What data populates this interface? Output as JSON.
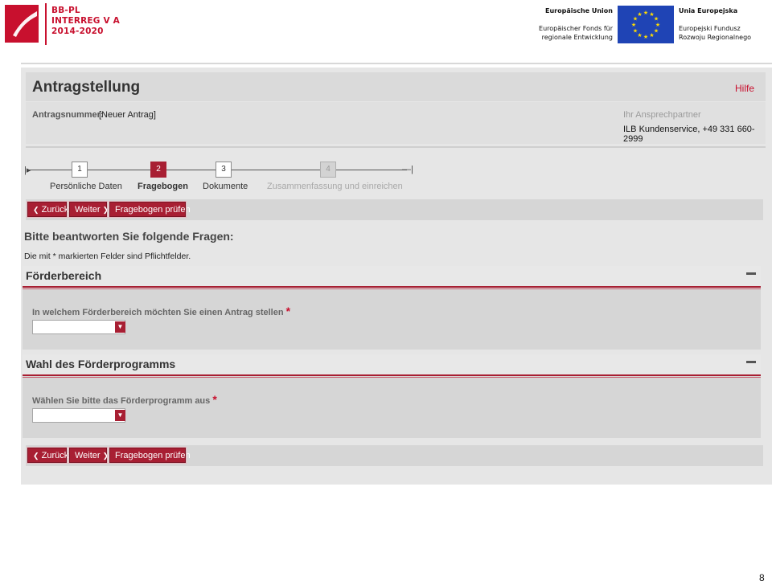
{
  "header": {
    "logo_lines": [
      "BB-PL",
      "INTERREG V A",
      "2014-2020"
    ],
    "eu_left_title": "Europäische Union",
    "eu_left_sub": [
      "Europäischer Fonds für",
      "regionale Entwicklung"
    ],
    "eu_right_title": "Unia Europejska",
    "eu_right_sub": [
      "Europejski Fundusz",
      "Rozwoju Regionalnego"
    ]
  },
  "page": {
    "title": "Antragstellung",
    "help": "Hilfe",
    "application_label": "Antragsnummer:",
    "application_value": "[Neuer Antrag]",
    "contact_label": "Ihr Ansprechpartner",
    "contact_value": "ILB Kundenservice, +49 331 660-2999"
  },
  "steps": [
    {
      "num": "1",
      "label": "Persönliche Daten"
    },
    {
      "num": "2",
      "label": "Fragebogen"
    },
    {
      "num": "3",
      "label": "Dokumente"
    },
    {
      "num": "4",
      "label": "Zusammenfassung und einreichen"
    }
  ],
  "buttons": {
    "back": "Zurück",
    "next": "Weiter",
    "check": "Fragebogen prüfen"
  },
  "icons": {
    "back": "chevron-left-icon",
    "next": "chevron-right-icon",
    "collapse": "minus-icon"
  },
  "questions": {
    "heading": "Bitte beantworten Sie folgende Fragen:",
    "note": "Die mit * markierten Felder sind Pflichtfelder."
  },
  "sections": [
    {
      "title": "Förderbereich",
      "field_label": "In welchem Förderbereich möchten Sie einen Antrag stellen",
      "required": "*",
      "selected": ""
    },
    {
      "title": "Wahl des Förderprogramms",
      "field_label": "Wählen Sie bitte das Förderprogramm aus",
      "required": "*",
      "selected": ""
    }
  ],
  "footer": {
    "page_number": "8"
  },
  "colors": {
    "accent": "#a81f33",
    "brand_red": "#c8102e",
    "eu_blue": "#1f44b5",
    "eu_star": "#ffdd00"
  }
}
